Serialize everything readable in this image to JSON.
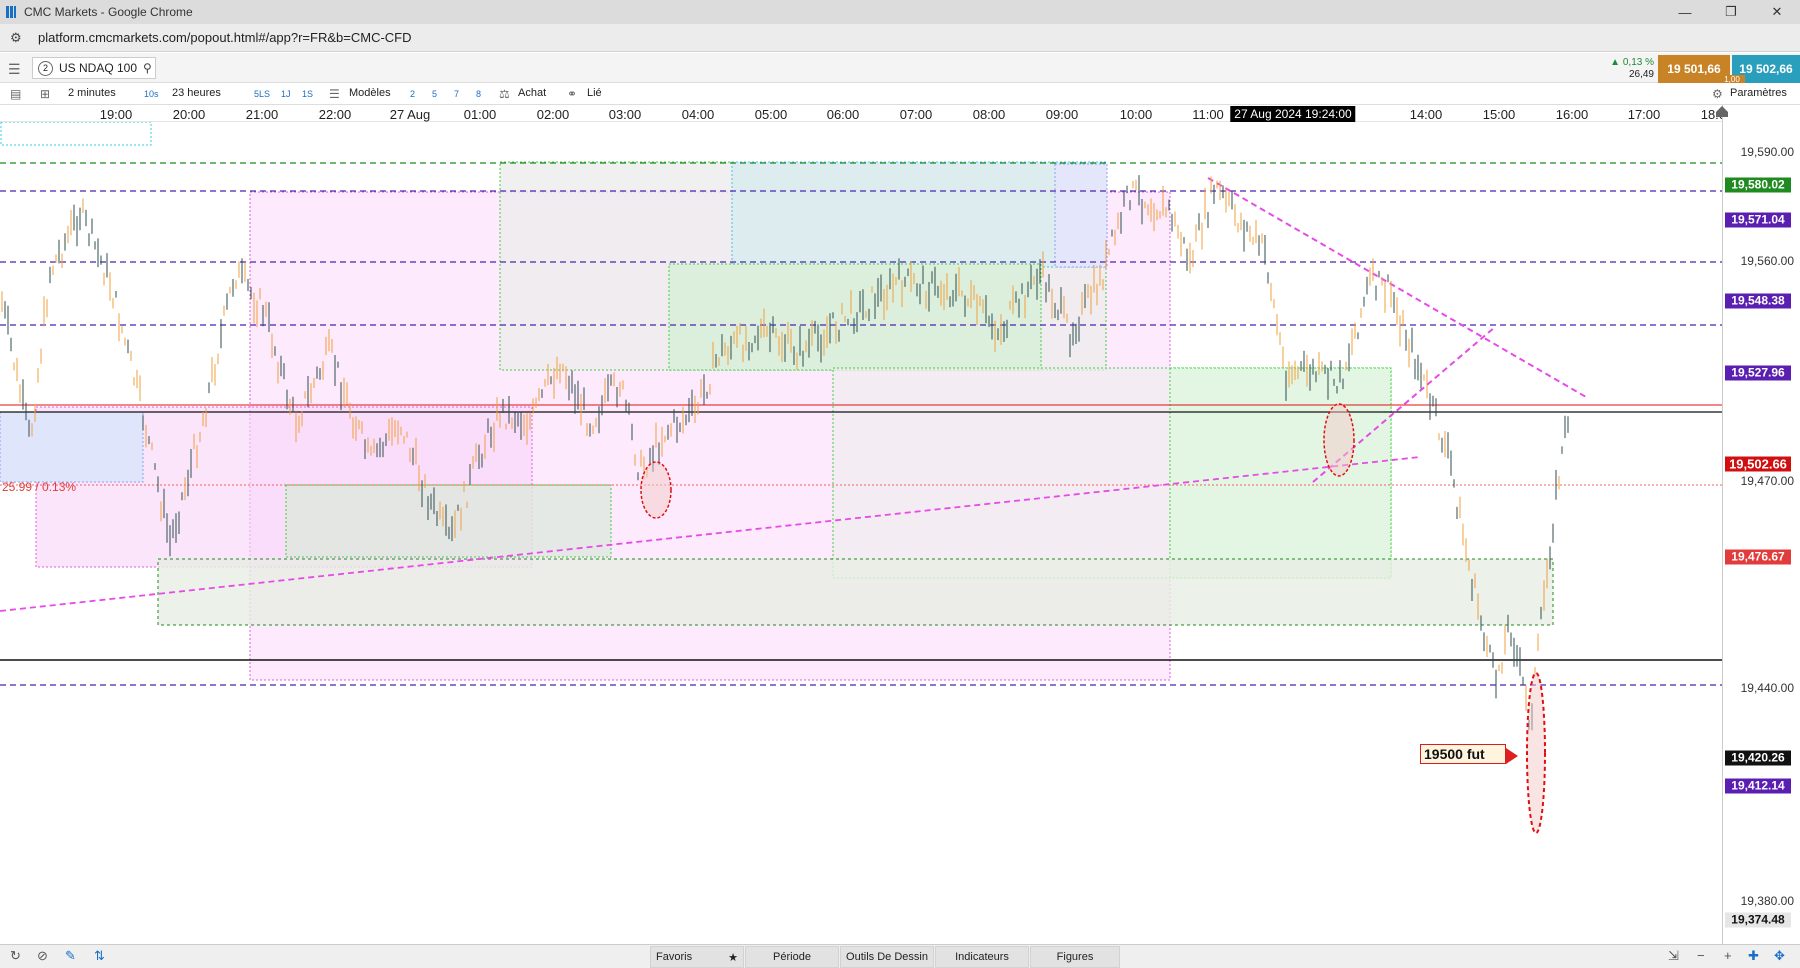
{
  "window": {
    "title": "CMC Markets - Google Chrome"
  },
  "browser": {
    "url": "platform.cmcmarkets.com/popout.html#/app?r=FR&b=CMC-CFD"
  },
  "instrument": {
    "tab_number": "2",
    "name": "US NDAQ 100",
    "change_pct": "0,13 %",
    "change_pts": "26,49",
    "sell": "19 501,66",
    "buy": "19 502,66",
    "spread": "1,00"
  },
  "toolbar": {
    "interval": "2 minutes",
    "bar10s": "10s",
    "range": "23 heures",
    "sls": "5LS",
    "r1j": "1J",
    "r1s": "1S",
    "templates": "Modèles",
    "n2": "2",
    "n5": "5",
    "n7": "7",
    "n8": "8",
    "achat": "Achat",
    "lie": "Lié",
    "settings": "Paramètres"
  },
  "time_axis": {
    "labels": [
      "19:00",
      "20:00",
      "21:00",
      "22:00",
      "27 Aug",
      "01:00",
      "02:00",
      "03:00",
      "04:00",
      "05:00",
      "06:00",
      "07:00",
      "08:00",
      "09:00",
      "10:00",
      "11:00",
      "14:00",
      "15:00",
      "16:00",
      "17:00",
      "18:00"
    ],
    "cursor": "27 Aug 2024 19:24:00"
  },
  "price_axis": {
    "ticks": [
      "19,590.00",
      "19,560.00",
      "19,470.00",
      "19,440.00",
      "19,380.00"
    ],
    "levels": [
      {
        "text": "19,580.02",
        "color": "#1f8a1f"
      },
      {
        "text": "19,571.04",
        "color": "#5a1fb0"
      },
      {
        "text": "19,548.38",
        "color": "#5a1fb0"
      },
      {
        "text": "19,527.96",
        "color": "#5a1fb0"
      },
      {
        "text": "19,502.66",
        "color": "#d01010"
      },
      {
        "text": "19,476.67",
        "color": "#e23b3b"
      },
      {
        "text": "19,420.26",
        "color": "#111111"
      },
      {
        "text": "19,412.14",
        "color": "#5a1fb0"
      },
      {
        "text": "19,374.48",
        "color": "#e6e6e6"
      }
    ]
  },
  "annotations": {
    "pct_change": "25.99 / 0.13%",
    "fut_label": "19500 fut"
  },
  "bottom": {
    "favoris": "Favoris",
    "periode": "Période",
    "drawing_tools": "Outils De Dessin",
    "indicators": "Indicateurs",
    "figures": "Figures"
  },
  "chart_data": {
    "type": "candlestick",
    "instrument": "US NDAQ 100",
    "interval": "2 minutes",
    "range": "23 heures",
    "last_price": 19502.66,
    "horizontal_levels": [
      19580.02,
      19571.04,
      19548.38,
      19527.96,
      19502.66,
      19476.67,
      19420.26,
      19412.14,
      19374.48
    ],
    "y_ticks": [
      19590,
      19560,
      19470,
      19440,
      19380
    ]
  }
}
